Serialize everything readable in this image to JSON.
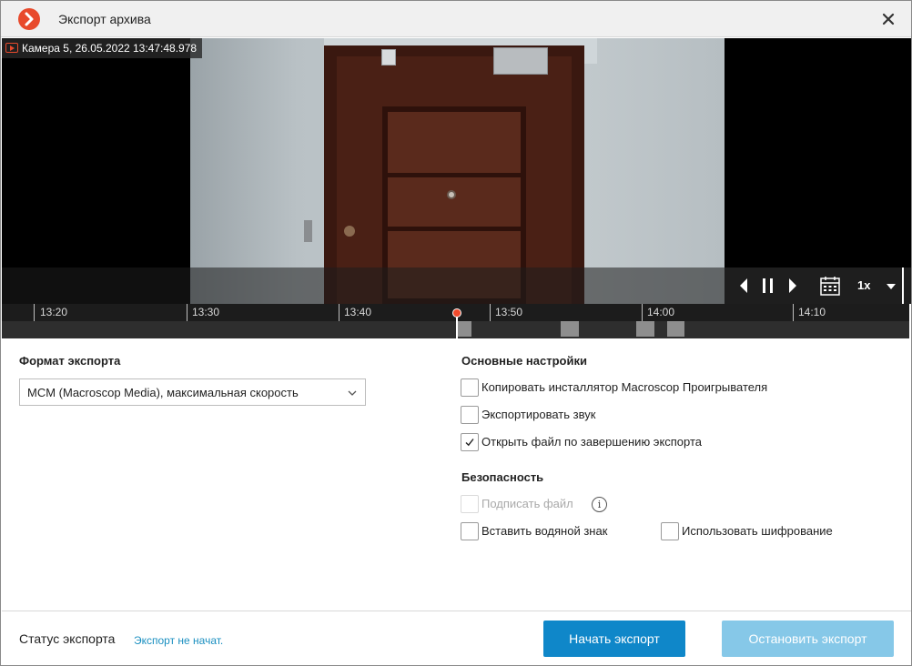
{
  "window": {
    "title": "Экспорт архива"
  },
  "video": {
    "camera_label": "Камера 5, 26.05.2022 13:47:48.978",
    "speed": "1x"
  },
  "timeline": {
    "ticks": [
      "13:20",
      "13:30",
      "13:40",
      "13:50",
      "14:00",
      "14:10"
    ]
  },
  "export_format": {
    "title": "Формат экспорта",
    "selected": "MCM (Macroscop Media), максимальная скорость"
  },
  "basic_settings": {
    "title": "Основные настройки",
    "options": [
      {
        "label": "Копировать инсталлятор Macroscop Проигрывателя",
        "checked": false,
        "enabled": true
      },
      {
        "label": "Экспортировать звук",
        "checked": false,
        "enabled": true
      },
      {
        "label": "Открыть файл по завершению экспорта",
        "checked": true,
        "enabled": true
      }
    ]
  },
  "security": {
    "title": "Безопасность",
    "options": [
      {
        "label": "Подписать файл",
        "checked": false,
        "enabled": false
      },
      {
        "label": "Вставить водяной знак",
        "checked": false,
        "enabled": true
      },
      {
        "label": "Использовать шифрование",
        "checked": false,
        "enabled": true
      }
    ]
  },
  "footer": {
    "status_label": "Статус экспорта",
    "status_value": "Экспорт не начат.",
    "start_button": "Начать экспорт",
    "stop_button": "Остановить экспорт"
  },
  "icons": {
    "logo": "macroscop-logo-icon",
    "close": "close-icon",
    "camera": "camera-record-icon",
    "prev": "previous-frame-icon",
    "pause": "pause-icon",
    "next": "next-frame-icon",
    "calendar": "calendar-icon",
    "dropdown": "chevron-down-icon",
    "info": "info-icon",
    "check": "checkmark-icon"
  },
  "colors": {
    "accent": "#0f87c9",
    "accent_disabled": "#86c8e8",
    "logo": "#e84a2c",
    "timeline_cursor": "#f04a2c",
    "status_text": "#1a8fc0"
  }
}
